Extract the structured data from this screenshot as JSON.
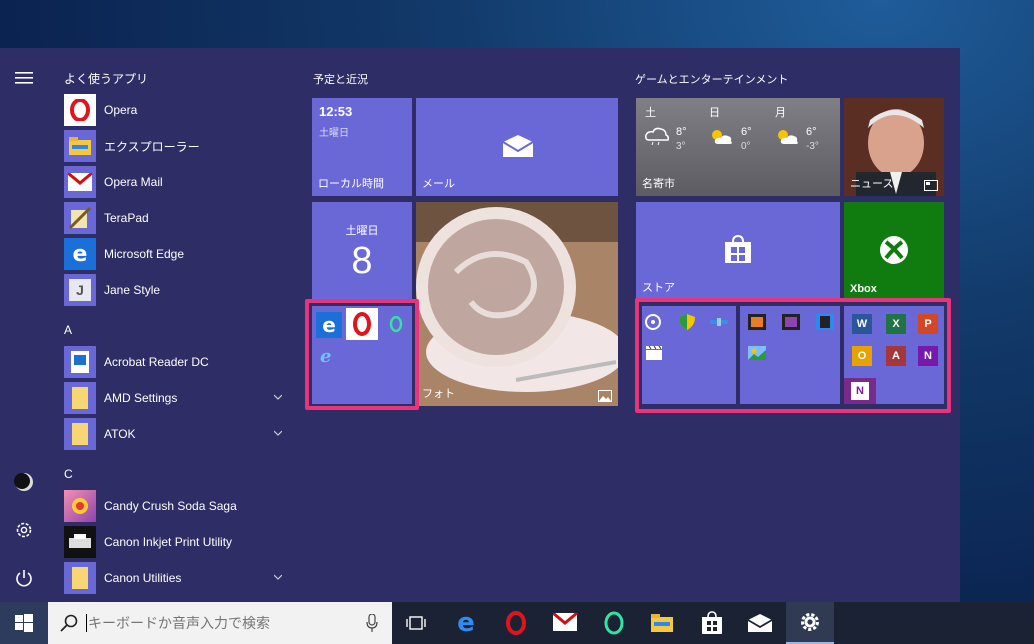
{
  "sidebar": {
    "icons": [
      "hamburger-icon",
      "user-avatar",
      "settings-icon",
      "power-icon"
    ]
  },
  "applist": {
    "frequent_header": "よく使うアプリ",
    "frequent": [
      {
        "label": "Opera",
        "icon": "opera-icon"
      },
      {
        "label": "エクスプローラー",
        "icon": "explorer-icon"
      },
      {
        "label": "Opera  Mail",
        "icon": "opera-mail-icon"
      },
      {
        "label": "TeraPad",
        "icon": "terapad-icon"
      },
      {
        "label": "Microsoft Edge",
        "icon": "edge-icon"
      },
      {
        "label": "Jane Style",
        "icon": "jane-style-icon"
      }
    ],
    "section_a": "A",
    "a_items": [
      {
        "label": "Acrobat Reader DC"
      },
      {
        "label": "AMD Settings"
      },
      {
        "label": "ATOK"
      }
    ],
    "section_c": "C",
    "c_items": [
      {
        "label": "Candy Crush Soda Saga"
      },
      {
        "label": "Canon Inkjet Print Utility"
      },
      {
        "label": "Canon Utilities"
      }
    ]
  },
  "group1": {
    "title": "予定と近況",
    "clock_time": "12:53",
    "clock_day": "土曜日",
    "clock_label": "ローカル時間",
    "mail_label": "メール",
    "calendar_weekday": "土曜日",
    "calendar_day": "8",
    "photo_label": "フォト"
  },
  "group2": {
    "title": "ゲームとエンターテインメント",
    "weather_city": "名寄市",
    "weather": [
      {
        "day": "土",
        "high": "8°",
        "low": "3°"
      },
      {
        "day": "日",
        "high": "6°",
        "low": "0°"
      },
      {
        "day": "月",
        "high": "6°",
        "low": "-3°"
      }
    ],
    "news_label": "ニュース",
    "store_label": "ストア",
    "xbox_label": "Xbox",
    "office_letters": [
      "W",
      "X",
      "P",
      "O",
      "A",
      "N"
    ]
  },
  "taskbar": {
    "search_placeholder": "キーボードか音声入力で検索"
  },
  "colors": {
    "accent": "#6a67d6",
    "highlight": "#e8347a",
    "start_bg": "#2f2d66",
    "xbox": "#107c10"
  }
}
